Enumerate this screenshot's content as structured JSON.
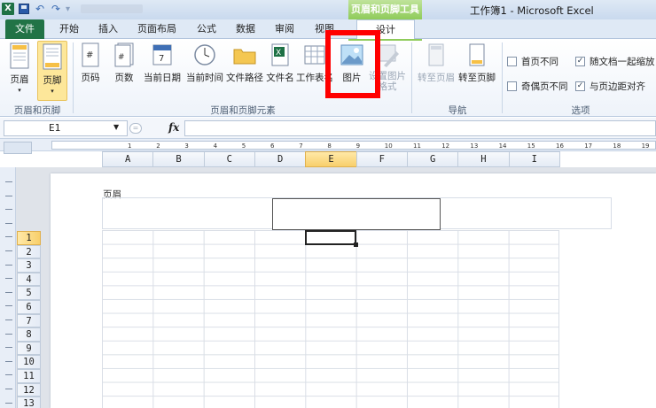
{
  "window": {
    "title": "工作簿1 - Microsoft Excel",
    "context_tab": "页眉和页脚工具"
  },
  "tabs": [
    {
      "label": "文件"
    },
    {
      "label": "开始"
    },
    {
      "label": "插入"
    },
    {
      "label": "页面布局"
    },
    {
      "label": "公式"
    },
    {
      "label": "数据"
    },
    {
      "label": "审阅"
    },
    {
      "label": "视图"
    },
    {
      "label": "设计"
    }
  ],
  "ribbon": {
    "group_header_footer": {
      "title": "页眉和页脚",
      "header": "页眉",
      "footer": "页脚"
    },
    "group_elements": {
      "title": "页眉和页脚元素",
      "page_number": "页码",
      "page_count": "页数",
      "current_date": "当前日期",
      "current_time": "当前时间",
      "file_path": "文件路径",
      "file_name": "文件名",
      "sheet_name": "工作表名",
      "picture": "图片",
      "format_picture": "设置图片格式"
    },
    "group_nav": {
      "title": "导航",
      "goto_header": "转至页眉",
      "goto_footer": "转至页脚"
    },
    "group_options": {
      "title": "选项",
      "diff_first": {
        "label": "首页不同",
        "checked": false
      },
      "diff_odd_even": {
        "label": "奇偶页不同",
        "checked": false
      },
      "scale_with_doc": {
        "label": "随文档一起缩放",
        "checked": true
      },
      "align_margins": {
        "label": "与页边距对齐",
        "checked": true
      }
    }
  },
  "formula_bar": {
    "name_box": "E1",
    "fx": "fx",
    "value": ""
  },
  "ruler_numbers": [
    "1",
    "2",
    "3",
    "4",
    "5",
    "6",
    "7",
    "8",
    "9",
    "10",
    "11",
    "12",
    "13",
    "14",
    "15",
    "16",
    "17",
    "18",
    "19"
  ],
  "columns": [
    "A",
    "B",
    "C",
    "D",
    "E",
    "F",
    "G",
    "H",
    "I"
  ],
  "selected_column": "E",
  "rows": [
    "1",
    "2",
    "3",
    "4",
    "5",
    "6",
    "7",
    "8",
    "9",
    "10",
    "11",
    "12",
    "13"
  ],
  "selected_row": "1",
  "page": {
    "header_label": "页眉"
  },
  "colors": {
    "file_tab": "#217346",
    "context_tab": "#8fcb5a",
    "highlight": "#fde79a",
    "annotation_red": "#ff0000"
  }
}
